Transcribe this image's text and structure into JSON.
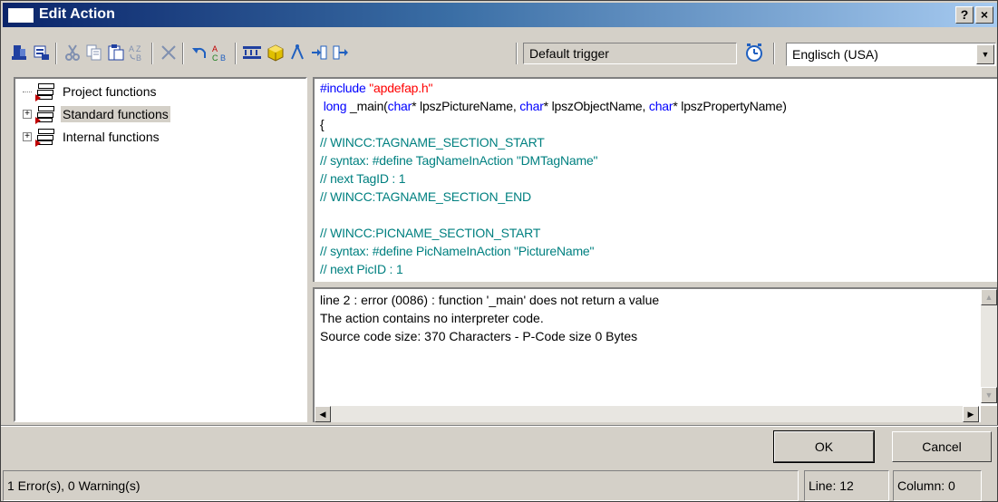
{
  "window": {
    "title": "Edit Action",
    "help_label": "?",
    "close_label": "×"
  },
  "toolbar": {
    "trigger": "Default trigger",
    "language": "Englisch (USA)"
  },
  "tree": {
    "items": [
      {
        "label": "Project functions",
        "expandable": false,
        "selected": false
      },
      {
        "label": "Standard functions",
        "expandable": true,
        "selected": true
      },
      {
        "label": "Internal functions",
        "expandable": true,
        "selected": false
      }
    ],
    "expander_glyph": "+"
  },
  "code": {
    "include_directive": "#include",
    "include_file": "\"apdefap.h\"",
    "sig_long": " long",
    "sig_main": " _main(",
    "sig_char1": "char",
    "sig_p1": "* lpszPictureName, ",
    "sig_char2": "char",
    "sig_p2": "* lpszObjectName, ",
    "sig_char3": "char",
    "sig_p3": "* lpszPropertyName)",
    "brace": "{",
    "c1": "// WINCC:TAGNAME_SECTION_START",
    "c2": "// syntax: #define TagNameInAction \"DMTagName\"",
    "c3": "// next TagID : 1",
    "c4": "// WINCC:TAGNAME_SECTION_END",
    "c5": "// WINCC:PICNAME_SECTION_START",
    "c6": "// syntax: #define PicNameInAction \"PictureName\"",
    "c7": "// next PicID : 1"
  },
  "output": {
    "lines": [
      "line 2 : error (0086) : function '_main' does not return a value",
      "The action contains no interpreter code.",
      "Source code size: 370 Characters - P-Code size 0 Bytes"
    ]
  },
  "buttons": {
    "ok": "OK",
    "cancel": "Cancel"
  },
  "status": {
    "messages": "1 Error(s), 0 Warning(s)",
    "line": "Line: 12",
    "column": "Column: 0"
  },
  "colors": {
    "keyword": "#0000ff",
    "string": "#ff0000",
    "comment": "#008080",
    "titlebar_start": "#0a246a",
    "titlebar_end": "#a6caf0"
  },
  "icons": [
    "compile-all-icon",
    "compile-icon",
    "cut-icon",
    "copy-icon",
    "paste-icon",
    "replace-icon",
    "delete-icon",
    "undo-icon",
    "spell-check-icon",
    "tag-icon",
    "object-icon",
    "properties-icon",
    "import-icon",
    "export-icon",
    "trigger-clock-icon"
  ]
}
